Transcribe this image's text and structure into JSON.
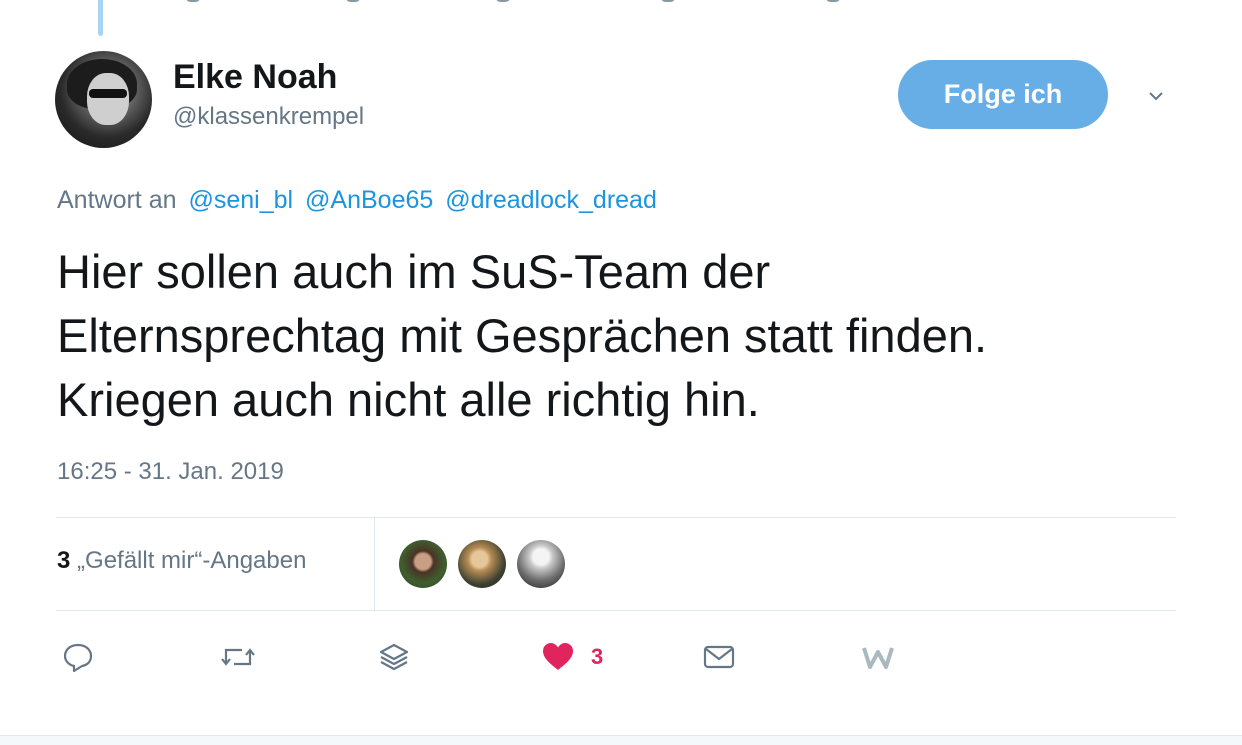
{
  "author": {
    "name": "Elke Noah",
    "handle": "@klassenkrempel"
  },
  "follow_button": {
    "label": "Folge ich"
  },
  "reply": {
    "prefix": "Antwort an",
    "mentions": [
      "@seni_bl",
      "@AnBoe65",
      "@dreadlock_dread"
    ]
  },
  "tweet": {
    "lines": [
      "Hier sollen auch im SuS-Team der",
      "Elternsprechtag mit Gesprächen statt finden.",
      "Kriegen auch nicht alle richtig hin."
    ],
    "timestamp": "16:25 - 31. Jan. 2019"
  },
  "stats": {
    "likes_number": "3",
    "likes_label": "„Gefällt mir“-Angaben"
  },
  "actions": {
    "reply_icon": "reply-icon",
    "retweet_icon": "retweet-icon",
    "stack_icon": "layers-icon",
    "like_icon": "heart-icon",
    "like_count": "3",
    "mail_icon": "mail-icon",
    "extra_icon": "w-icon"
  },
  "colors": {
    "follow_button": "#67aee6",
    "link": "#1b95e0",
    "secondary_text": "#657786",
    "like": "#e0245e"
  }
}
